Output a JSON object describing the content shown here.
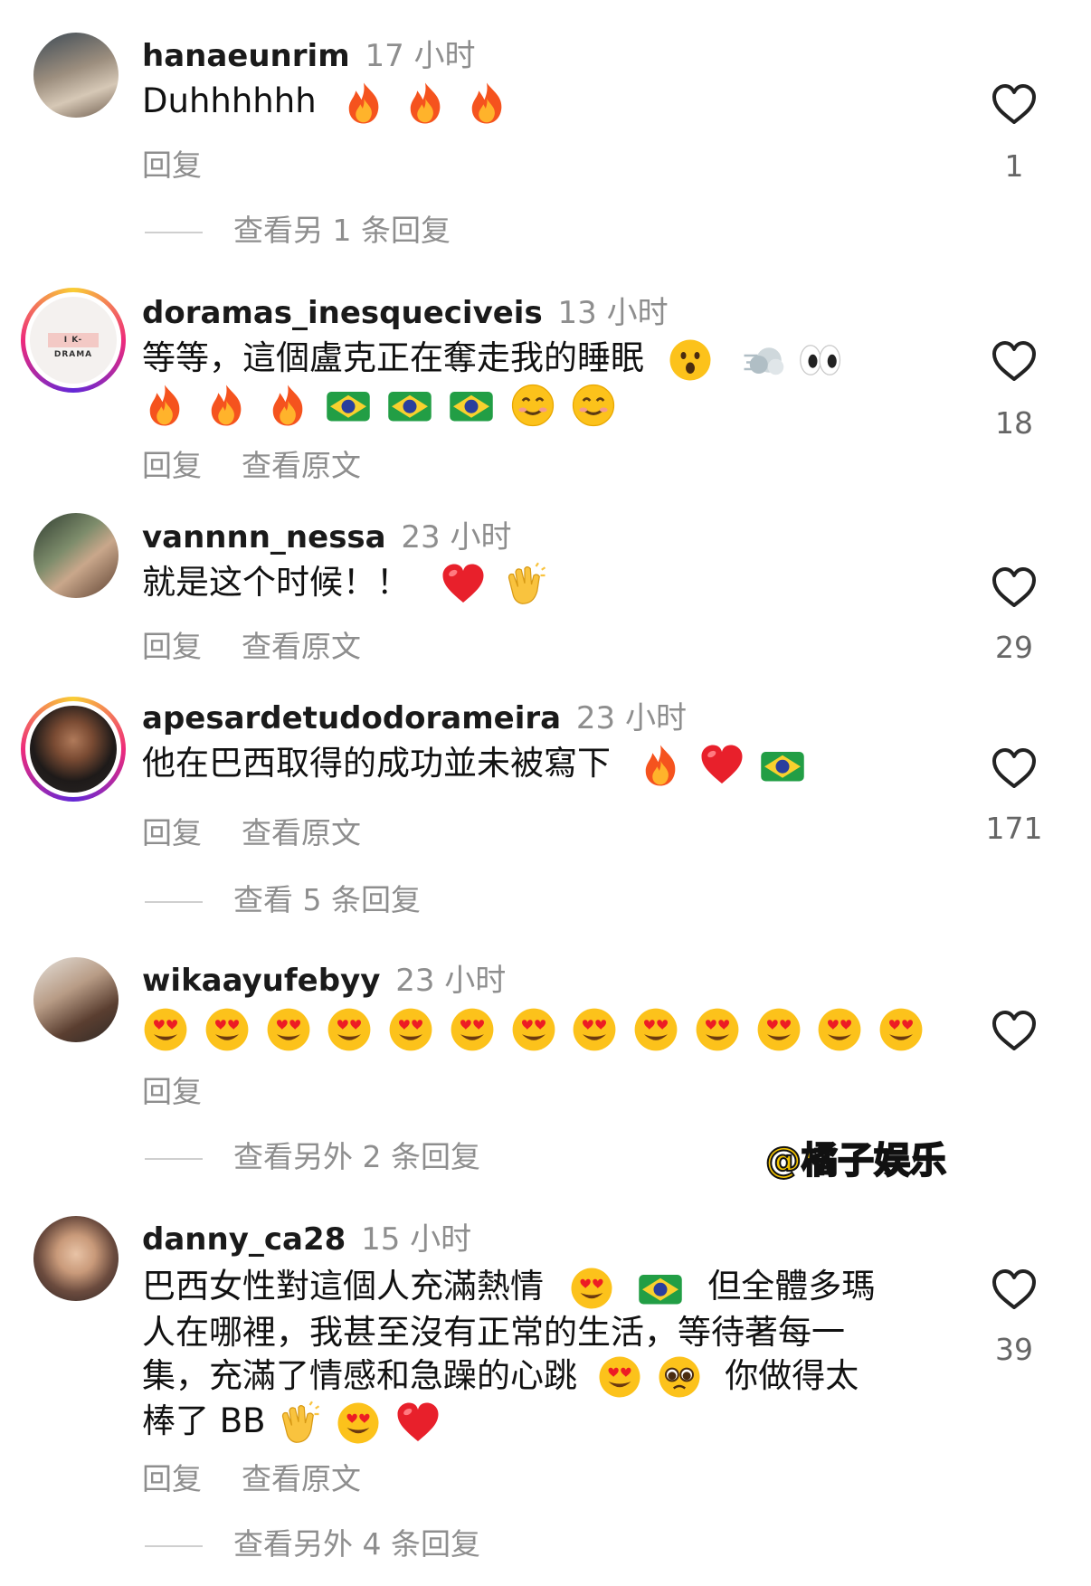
{
  "comments": [
    {
      "username": "hanaeunrim",
      "time": "17 小时",
      "text": "Duhhhhhh",
      "reply_label": "回复",
      "likes": "1",
      "more_replies": "查看另 1 条回复",
      "emoji_icons": [
        "fire-emoji",
        "fire-emoji",
        "fire-emoji"
      ]
    },
    {
      "username": "doramas_inesqueciveis",
      "time": "13 小时",
      "text": "等等，這個盧克正在奪走我的睡眠",
      "reply_label": "回复",
      "see_original_label": "查看原文",
      "likes": "18",
      "avatar_text": "I K-DRAMA",
      "emoji_icons": [
        "astonished-face-emoji",
        "dash-emoji",
        "eyes-emoji",
        "fire-emoji",
        "fire-emoji",
        "fire-emoji",
        "brazil-flag-emoji",
        "brazil-flag-emoji",
        "brazil-flag-emoji",
        "smiling-face-emoji",
        "smiling-face-emoji"
      ]
    },
    {
      "username": "vannnn_nessa",
      "time": "23 小时",
      "text": "就是这个时候！！",
      "reply_label": "回复",
      "see_original_label": "查看原文",
      "likes": "29",
      "emoji_icons": [
        "red-heart-emoji",
        "clapping-hands-emoji"
      ]
    },
    {
      "username": "apesardetudodorameira",
      "time": "23 小时",
      "text": "他在巴西取得的成功並未被寫下",
      "reply_label": "回复",
      "see_original_label": "查看原文",
      "likes": "171",
      "more_replies": "查看 5 条回复",
      "emoji_icons": [
        "fire-emoji",
        "red-heart-emoji",
        "brazil-flag-emoji"
      ]
    },
    {
      "username": "wikaayufebyy",
      "time": "23 小时",
      "text": "",
      "reply_label": "回复",
      "more_replies": "查看另外 2 条回复",
      "emoji_icons": [
        "heart-eyes-emoji",
        "heart-eyes-emoji",
        "heart-eyes-emoji",
        "heart-eyes-emoji",
        "heart-eyes-emoji",
        "heart-eyes-emoji",
        "heart-eyes-emoji",
        "heart-eyes-emoji",
        "heart-eyes-emoji",
        "heart-eyes-emoji",
        "heart-eyes-emoji",
        "heart-eyes-emoji",
        "heart-eyes-emoji"
      ]
    },
    {
      "username": "danny_ca28",
      "time": "15 小时",
      "text_parts": [
        "巴西女性對這個人充滿熱情",
        "但全體多瑪",
        "人在哪裡，我甚至沒有正常的生活，等待著每一",
        "集，充滿了情感和急躁的心跳",
        "你做得太",
        "棒了 BB"
      ],
      "reply_label": "回复",
      "see_original_label": "查看原文",
      "likes": "39",
      "more_replies": "查看另外 4 条回复",
      "emoji_icons": [
        "heart-eyes-emoji",
        "brazil-flag-emoji",
        "heart-eyes-emoji",
        "pleading-face-emoji",
        "clapping-hands-emoji",
        "heart-eyes-emoji",
        "red-heart-emoji"
      ]
    }
  ],
  "watermark": "@橘子娱乐",
  "colors": {
    "muted": "#8e8e8e",
    "heart_outline": "#222222",
    "watermark": "#f2c300"
  }
}
